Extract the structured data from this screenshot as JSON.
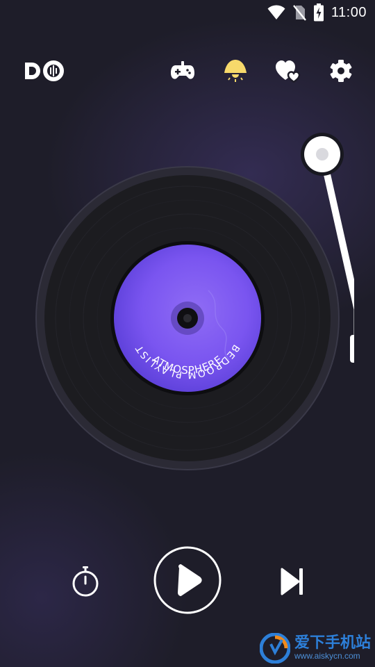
{
  "status_bar": {
    "time": "11:00",
    "icons": [
      "wifi-icon",
      "no-sim-icon",
      "battery-charging-icon"
    ]
  },
  "app": {
    "logo_text": "DO"
  },
  "toolbar": {
    "buttons": [
      "game-controller-icon",
      "lamp-icon",
      "hearts-icon",
      "gear-icon"
    ],
    "lamp_color": "#f7d96b"
  },
  "record": {
    "label_top": "BEDROOM PLAYLIST",
    "label_bottom": "ATMOSPHERE",
    "label_color": "#7a55f0"
  },
  "controls": {
    "timer": "stopwatch-icon",
    "play": "play-icon",
    "next": "skip-next-icon"
  },
  "watermark": {
    "chinese": "爱下手机站",
    "url": "www.aiskycn.com"
  }
}
